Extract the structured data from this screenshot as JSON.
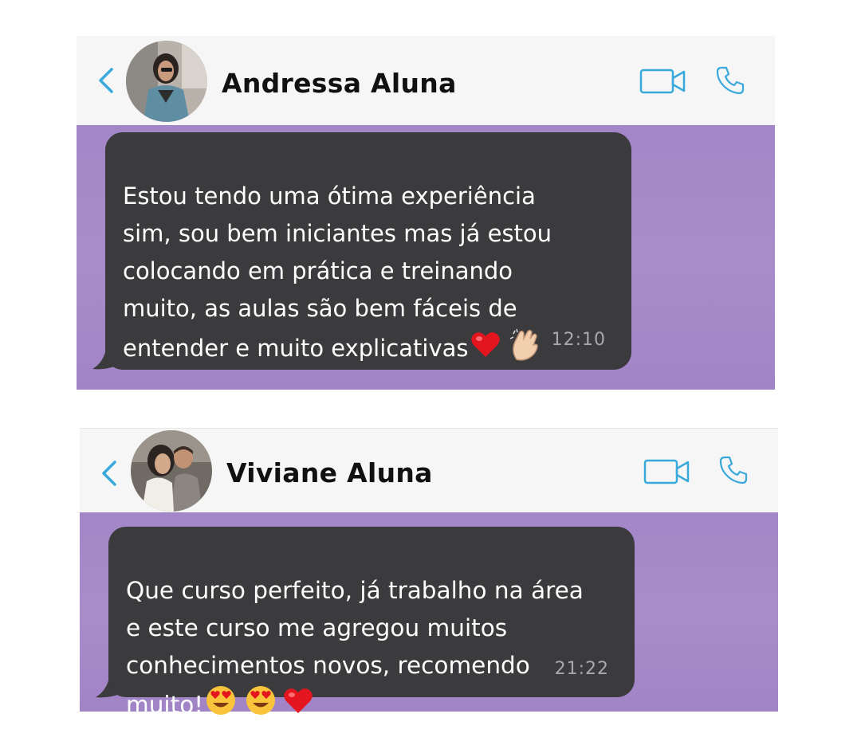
{
  "chats": [
    {
      "contact_name": "Andressa Aluna",
      "message": "Estou tendo uma ótima experiência\nsim, sou bem iniciantes mas já estou\ncolocando em prática e treinando\nmuito, as aulas são bem fáceis de\nentender e muito explicativas",
      "emojis": [
        "heart-emoji",
        "clapping-hands-emoji"
      ],
      "time": "12:10"
    },
    {
      "contact_name": "Viviane Aluna",
      "message": "Que curso perfeito, já trabalho na área\ne este curso me agregou muitos\nconhecimentos novos, recomendo\nmuito!",
      "emojis": [
        "heart-eyes-emoji",
        "heart-eyes-emoji",
        "heart-emoji"
      ],
      "time": "21:22"
    }
  ],
  "colors": {
    "accent": "#39a9dc",
    "bubble": "#3b3b3d",
    "wallpaper": "#a588c8",
    "header": "#f6f6f6"
  }
}
